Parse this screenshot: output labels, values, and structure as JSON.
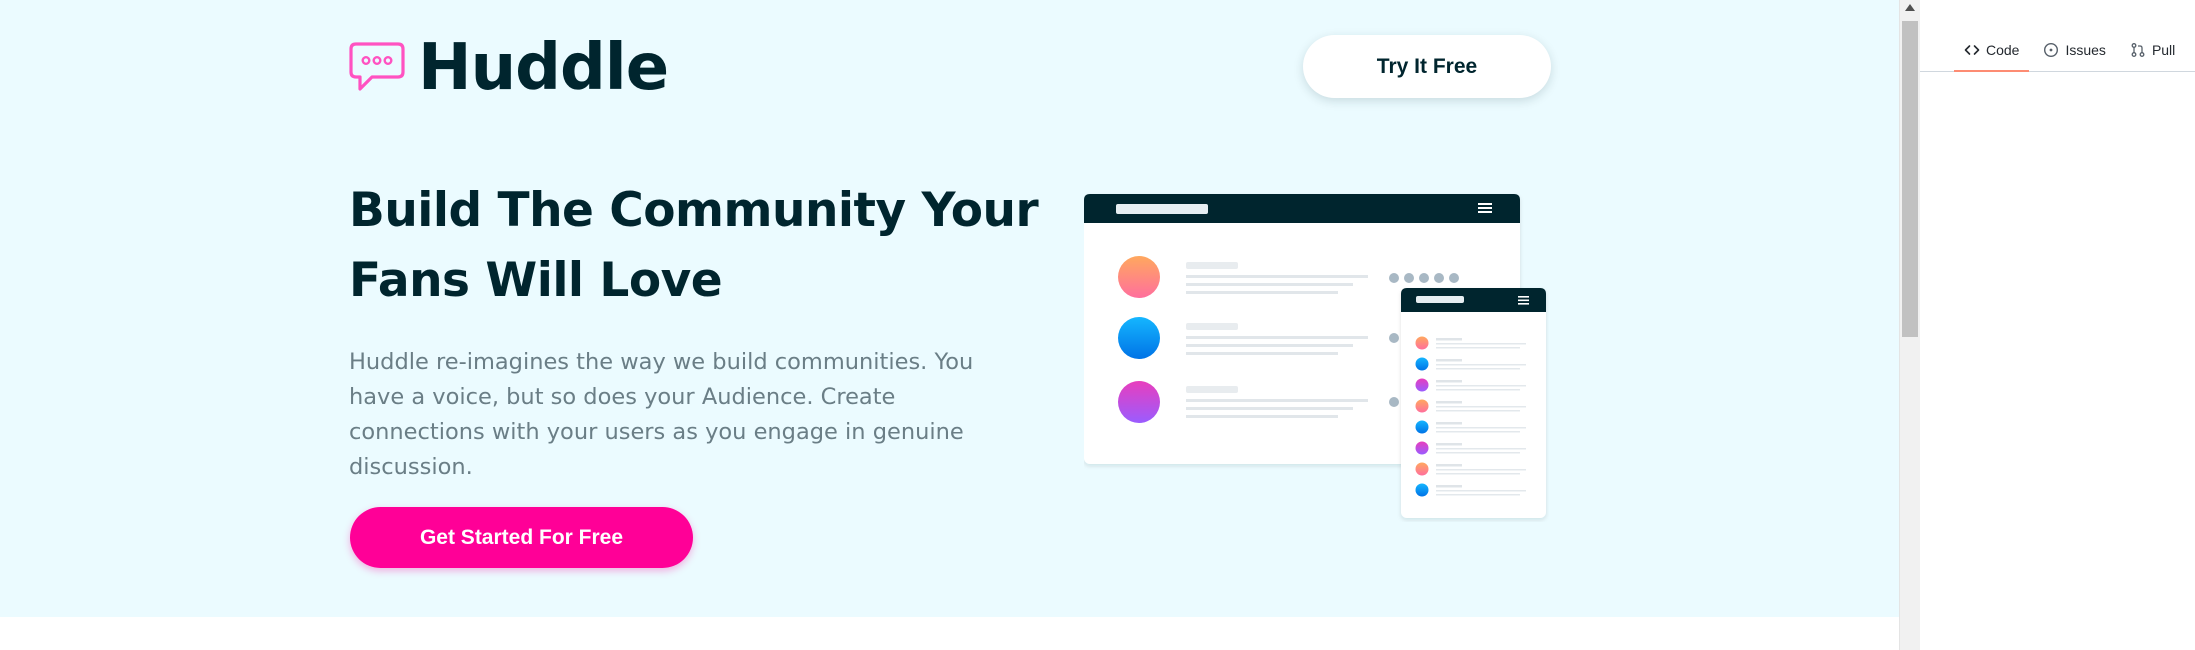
{
  "site": {
    "brand": "Huddle",
    "nav_button_label": "Try It Free",
    "headline_line1": "Build The Community Your",
    "headline_line2": "Fans Will Love",
    "description": "Huddle re-imagines the way we build communities. You have a voice, but so does your Audience. Create connections with your users as you engage in genuine discussion.",
    "cta_label": "Get Started For Free"
  },
  "panel": {
    "tabs": [
      {
        "label": "Code",
        "icon": "code-icon",
        "active": true
      },
      {
        "label": "Issues",
        "icon": "issue-icon",
        "active": false
      },
      {
        "label": "Pull",
        "icon": "pull-request-icon",
        "active": false
      }
    ]
  },
  "colors": {
    "hero_bg": "#ebfbff",
    "dark": "#00252e",
    "pink": "#ff0097",
    "text_muted": "#6a7e86"
  }
}
